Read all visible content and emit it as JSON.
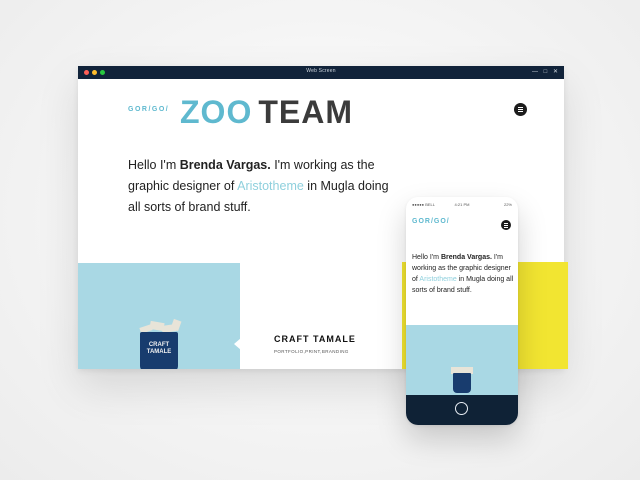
{
  "window": {
    "title": "Web Screen"
  },
  "header": {
    "brand_small": "GOR/GO/",
    "logo_zoo": "ZOO",
    "logo_team": "TEAM"
  },
  "intro": {
    "part1": "Hello I'm ",
    "name": "Brenda Vargas.",
    "part2": " I'm working as the graphic designer of ",
    "company": "Aristotheme",
    "part3": " in Mugla doing all sorts of brand stuff."
  },
  "project": {
    "title": "CRAFT TAMALE",
    "tags": "PORTFOLIO,PRINT,BRANDING",
    "cup_text_line1": "CRAFT",
    "cup_text_line2": "TAMALE"
  },
  "mobile": {
    "status_left": "●●●●● BELL",
    "status_time": "4:21 PM",
    "status_right": "22%",
    "brand": "GOR/GO/",
    "intro_part1": "Hello I'm ",
    "intro_name": "Brenda Vargas.",
    "intro_part2": " I'm working as the graphic designer of ",
    "intro_company": "Aristotheme",
    "intro_part3": " in Mugla doing all sorts of brand stuff."
  },
  "colors": {
    "accent": "#5fb9cf",
    "tile_blue": "#a9d8e4",
    "yellow": "#f2e531",
    "titlebar": "#11233a"
  },
  "icons": {
    "menu": "hamburger-menu-icon",
    "home": "home-button-icon"
  }
}
